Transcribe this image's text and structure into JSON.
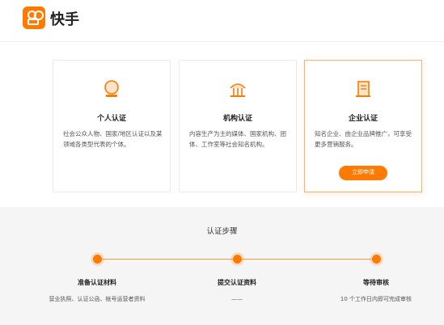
{
  "header": {
    "brand": "快手"
  },
  "cards": [
    {
      "icon": "person-badge-icon",
      "title": "个人认证",
      "desc": "社会公众人物、国家/地区认证以及某领域各类型代表的个体。"
    },
    {
      "icon": "institution-building-icon",
      "title": "机构认证",
      "desc": "内容生产为主的媒体、国家机构、团体、工作室等社会知名机构。"
    },
    {
      "icon": "enterprise-document-icon",
      "title": "企业认证",
      "desc": "知名企业、由企业品牌推广，可享受更多营销服务。",
      "button": "立即申请"
    }
  ],
  "steps": {
    "title": "认证步骤",
    "items": [
      {
        "title": "准备认证材料",
        "desc": "营业执照、认证公函、帐号运营者资料"
      },
      {
        "title": "提交认证资料",
        "desc": "——"
      },
      {
        "title": "等待审核",
        "desc": "10 个工作日内即可完成审核"
      }
    ]
  },
  "colors": {
    "accent": "#ff7a00",
    "background_steps": "#f5f5f5"
  }
}
